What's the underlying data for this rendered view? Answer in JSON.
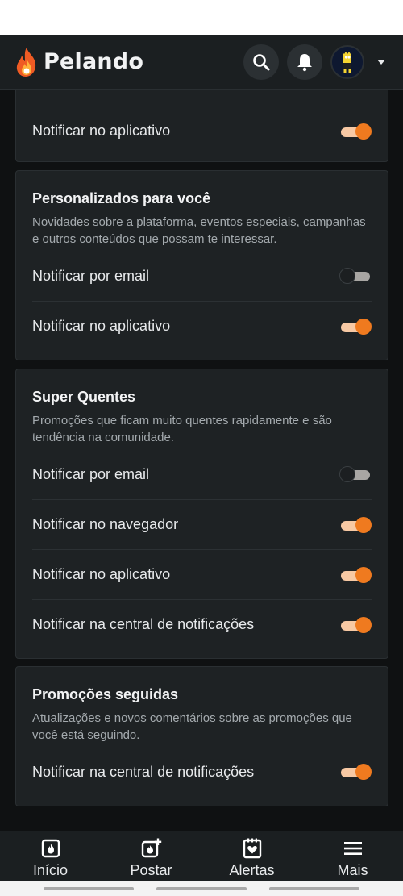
{
  "header": {
    "logo_text": "Pelando",
    "accent": "#ef7a1f"
  },
  "sections": [
    {
      "title": "",
      "rows": [
        {
          "label": "Notificar no aplicativo",
          "on": true
        }
      ]
    },
    {
      "title": "Personalizados para você",
      "description": "Novidades sobre a plataforma, eventos especiais, campanhas e outros conteúdos que possam te interessar.",
      "rows": [
        {
          "label": "Notificar por email",
          "on": false
        },
        {
          "label": "Notificar no aplicativo",
          "on": true
        }
      ]
    },
    {
      "title": "Super Quentes",
      "description": "Promoções que ficam muito quentes rapidamente e são tendência na comunidade.",
      "rows": [
        {
          "label": "Notificar por email",
          "on": false
        },
        {
          "label": "Notificar no navegador",
          "on": true
        },
        {
          "label": "Notificar no aplicativo",
          "on": true
        },
        {
          "label": "Notificar na central de notificações",
          "on": true
        }
      ]
    },
    {
      "title": "Promoções seguidas",
      "description": "Atualizações e novos comentários sobre as promoções que você está seguindo.",
      "rows": [
        {
          "label": "Notificar na central de notificações",
          "on": true
        }
      ]
    }
  ],
  "bottom_nav": [
    {
      "label": "Início",
      "icon": "home-flame-icon"
    },
    {
      "label": "Postar",
      "icon": "post-add-icon"
    },
    {
      "label": "Alertas",
      "icon": "alerts-heart-icon"
    },
    {
      "label": "Mais",
      "icon": "menu-icon"
    }
  ]
}
